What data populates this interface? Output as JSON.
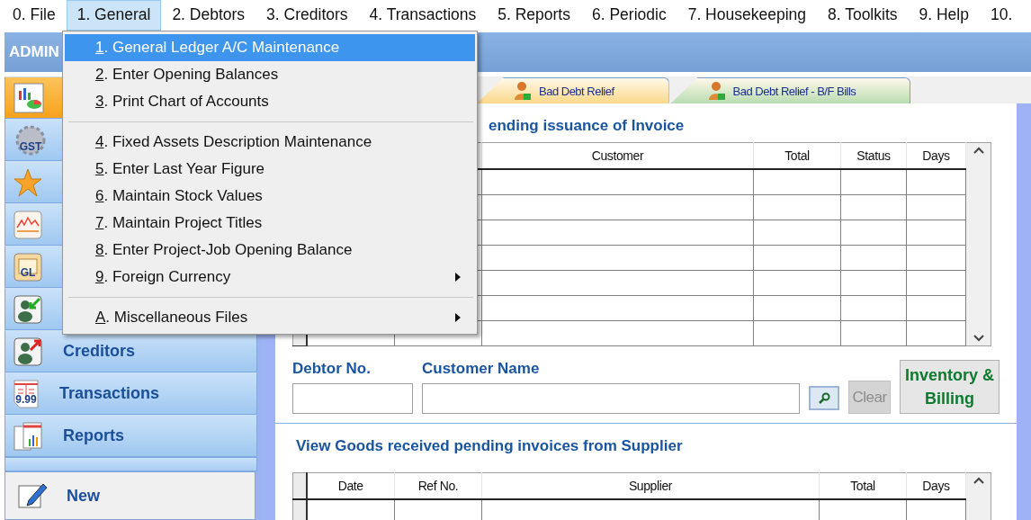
{
  "menu_bar": [
    {
      "label": "0. File",
      "selected": false
    },
    {
      "label": "1. General",
      "selected": true
    },
    {
      "label": "2. Debtors",
      "selected": false
    },
    {
      "label": "3. Creditors",
      "selected": false
    },
    {
      "label": "4. Transactions",
      "selected": false
    },
    {
      "label": "5. Reports",
      "selected": false
    },
    {
      "label": "6. Periodic",
      "selected": false
    },
    {
      "label": "7. Housekeeping",
      "selected": false
    },
    {
      "label": "8. Toolkits",
      "selected": false
    },
    {
      "label": "9. Help",
      "selected": false
    },
    {
      "label": "10.",
      "selected": false
    }
  ],
  "dropdown": [
    {
      "kind": "item",
      "label": "1. General Ledger A/C Maintenance",
      "selected": true,
      "submenu": false
    },
    {
      "kind": "item",
      "label": "2. Enter Opening Balances",
      "selected": false,
      "submenu": false
    },
    {
      "kind": "item",
      "label": "3. Print Chart of Accounts",
      "selected": false,
      "submenu": false
    },
    {
      "kind": "separator"
    },
    {
      "kind": "item",
      "label": "4. Fixed Assets Description Maintenance",
      "selected": false,
      "submenu": false
    },
    {
      "kind": "item",
      "label": "5. Enter Last Year Figure",
      "selected": false,
      "submenu": false
    },
    {
      "kind": "item",
      "label": "6. Maintain Stock Values",
      "selected": false,
      "submenu": false
    },
    {
      "kind": "item",
      "label": "7. Maintain Project Titles",
      "selected": false,
      "submenu": false
    },
    {
      "kind": "item",
      "label": "8. Enter Project-Job Opening Balance",
      "selected": false,
      "submenu": false
    },
    {
      "kind": "item",
      "label": "9. Foreign Currency",
      "selected": false,
      "submenu": true
    },
    {
      "kind": "separator"
    },
    {
      "kind": "item",
      "label": "A. Miscellaneous Files",
      "selected": false,
      "submenu": true
    }
  ],
  "header": {
    "title": "ADMIN"
  },
  "sidebar": {
    "items": [
      {
        "selected": true
      },
      {
        "icon_text": "GST",
        "selected": false
      },
      {
        "selected": false
      },
      {
        "selected": false
      },
      {
        "icon_text": "GL",
        "selected": false
      },
      {
        "selected": false
      },
      {
        "label": "Creditors",
        "selected": false
      },
      {
        "label": "Transactions",
        "icon_text": "9.99",
        "selected": false
      },
      {
        "label": "Reports",
        "selected": false
      }
    ],
    "new_button": {
      "label": "New"
    }
  },
  "tabs": [
    {
      "label": "Bad Debt Relief",
      "selected": false,
      "color": "#fcd88a"
    },
    {
      "label": "Bad Debt Relief - B/F Bills",
      "selected": false,
      "color": "#b8dcb2"
    }
  ],
  "invoice_section": {
    "title": "ending issuance of Invoice",
    "table": {
      "columns": [
        "Customer",
        "Total",
        "Status",
        "Days"
      ]
    }
  },
  "form": {
    "debtor_label": "Debtor No.",
    "customer_label": "Customer Name",
    "clear_button": "Clear",
    "clear_disabled": true,
    "inventory_button": "Inventory & Billing"
  },
  "goods_section": {
    "title": "View Goods received pending invoices from Supplier",
    "table": {
      "columns": [
        "Date",
        "Ref No.",
        "Supplier",
        "Total",
        "Days"
      ]
    }
  }
}
